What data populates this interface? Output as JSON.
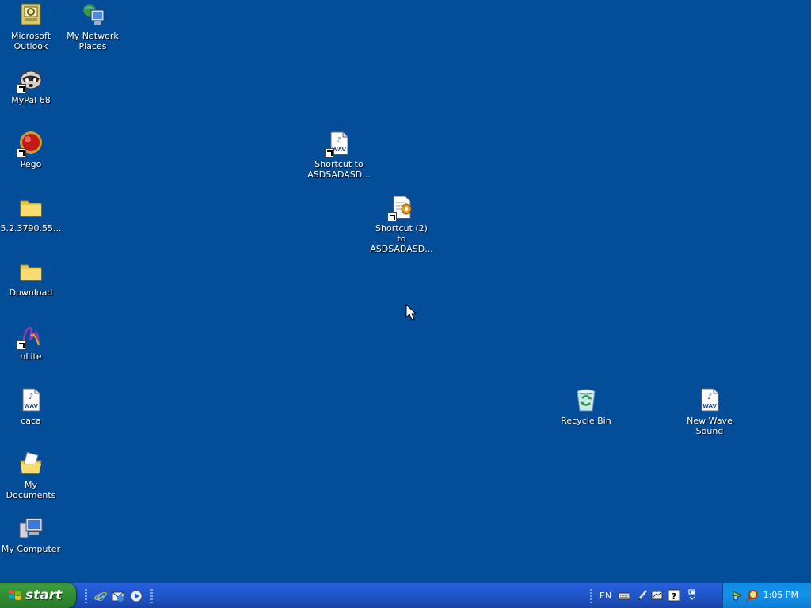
{
  "desktop": {
    "icons": [
      {
        "key": "outlook",
        "label": "Microsoft\nOutlook"
      },
      {
        "key": "network",
        "label": "My Network\nPlaces"
      },
      {
        "key": "mypal",
        "label": "MyPal 68"
      },
      {
        "key": "pego",
        "label": "Pego"
      },
      {
        "key": "folder1",
        "label": "5.2.3790.55..."
      },
      {
        "key": "download",
        "label": "Download"
      },
      {
        "key": "nlite",
        "label": "nLite"
      },
      {
        "key": "caca",
        "label": "caca"
      },
      {
        "key": "mydocs",
        "label": "My Documents"
      },
      {
        "key": "mycomp",
        "label": "My Computer"
      },
      {
        "key": "sc1",
        "label": "Shortcut to\nASDSADASD..."
      },
      {
        "key": "sc2",
        "label": "Shortcut (2) to\nASDSADASD..."
      },
      {
        "key": "recycle",
        "label": "Recycle Bin"
      },
      {
        "key": "newwave",
        "label": "New Wave\nSound"
      }
    ]
  },
  "taskbar": {
    "start_label": "start",
    "language": "EN",
    "clock": "1:05 PM"
  }
}
